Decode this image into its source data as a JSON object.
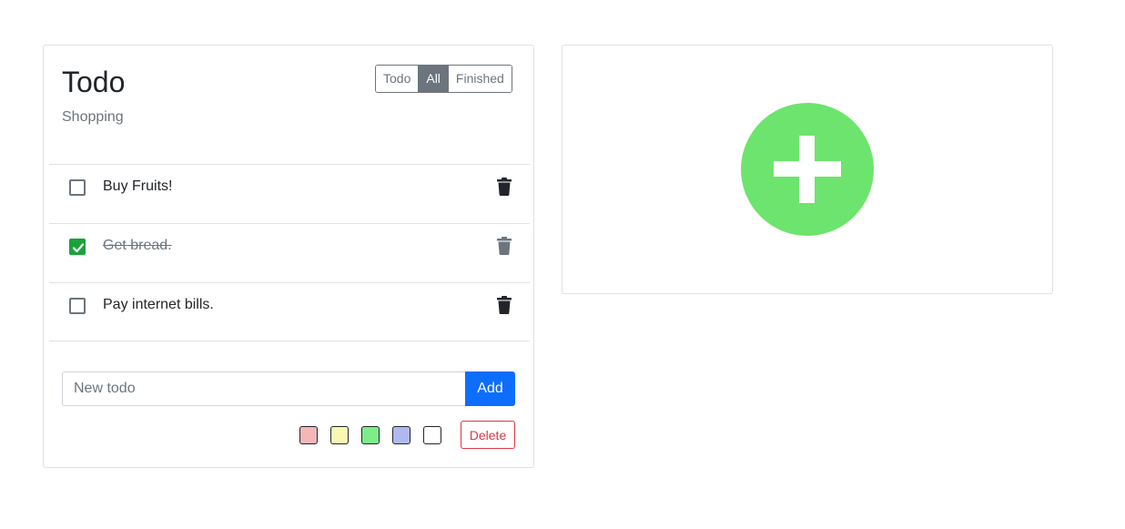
{
  "card": {
    "title": "Todo",
    "subtitle": "Shopping"
  },
  "filters": [
    {
      "label": "Todo",
      "active": false
    },
    {
      "label": "All",
      "active": true
    },
    {
      "label": "Finished",
      "active": false
    }
  ],
  "todos": [
    {
      "text": "Buy Fruits!",
      "done": false
    },
    {
      "text": "Get bread.",
      "done": true
    },
    {
      "text": "Pay internet bills.",
      "done": false
    }
  ],
  "new_todo": {
    "placeholder": "New todo",
    "value": "",
    "add_label": "Add"
  },
  "swatches": [
    "#f4b6b6",
    "#f8f8b0",
    "#7eec8a",
    "#b0b8f0",
    "#ffffff"
  ],
  "delete_label": "Delete",
  "colors": {
    "accent": "#0d6efd",
    "success": "#1aa33c",
    "danger": "#dc3545",
    "muted": "#6c757d",
    "add_circle": "#6de46d"
  },
  "icons": {
    "trash": "trash-icon",
    "check": "check-icon",
    "plus": "plus-icon"
  }
}
